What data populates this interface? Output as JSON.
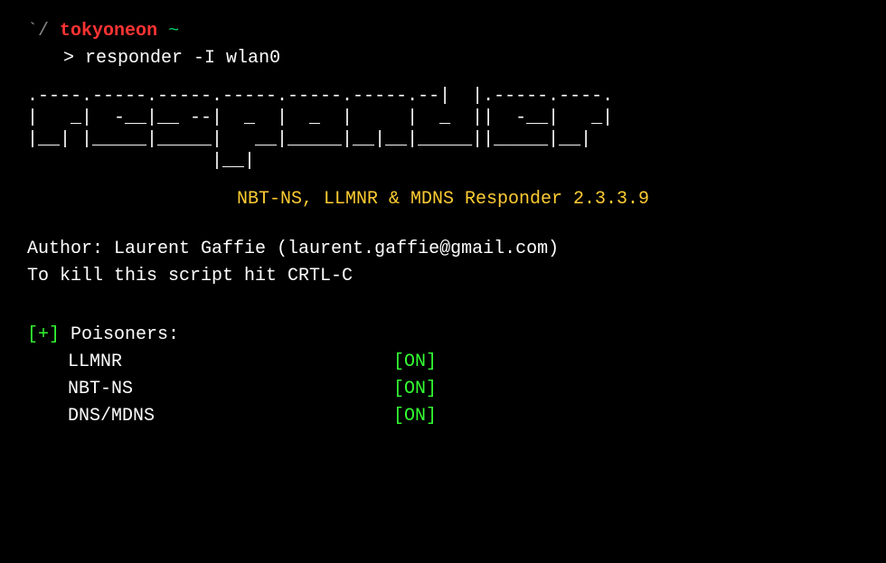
{
  "prompt": {
    "backtick": "`",
    "slash": "/",
    "username": "tokyoneon",
    "tilde": "~",
    "cursor": ">",
    "command": "responder -I wlan0"
  },
  "ascii": ".----.-----.-----.-----.-----.-----.--|  |.-----.----.\n|   _|  -__|__ --|  _  |  _  |     |  _  ||  -__|   _|\n|__| |_____|_____|   __|_____|__|__|_____||_____|__|\n                 |__|",
  "title": "NBT-NS, LLMNR & MDNS Responder 2.3.3.9",
  "author": "Author: Laurent Gaffie (laurent.gaffie@gmail.com)",
  "kill": "To kill this script hit CRTL-C",
  "section": {
    "plus": "[+]",
    "label": "Poisoners:"
  },
  "poisoners": {
    "item0": {
      "name": "LLMNR",
      "status": "[ON]"
    },
    "item1": {
      "name": "NBT-NS",
      "status": "[ON]"
    },
    "item2": {
      "name": "DNS/MDNS",
      "status": "[ON]"
    }
  }
}
